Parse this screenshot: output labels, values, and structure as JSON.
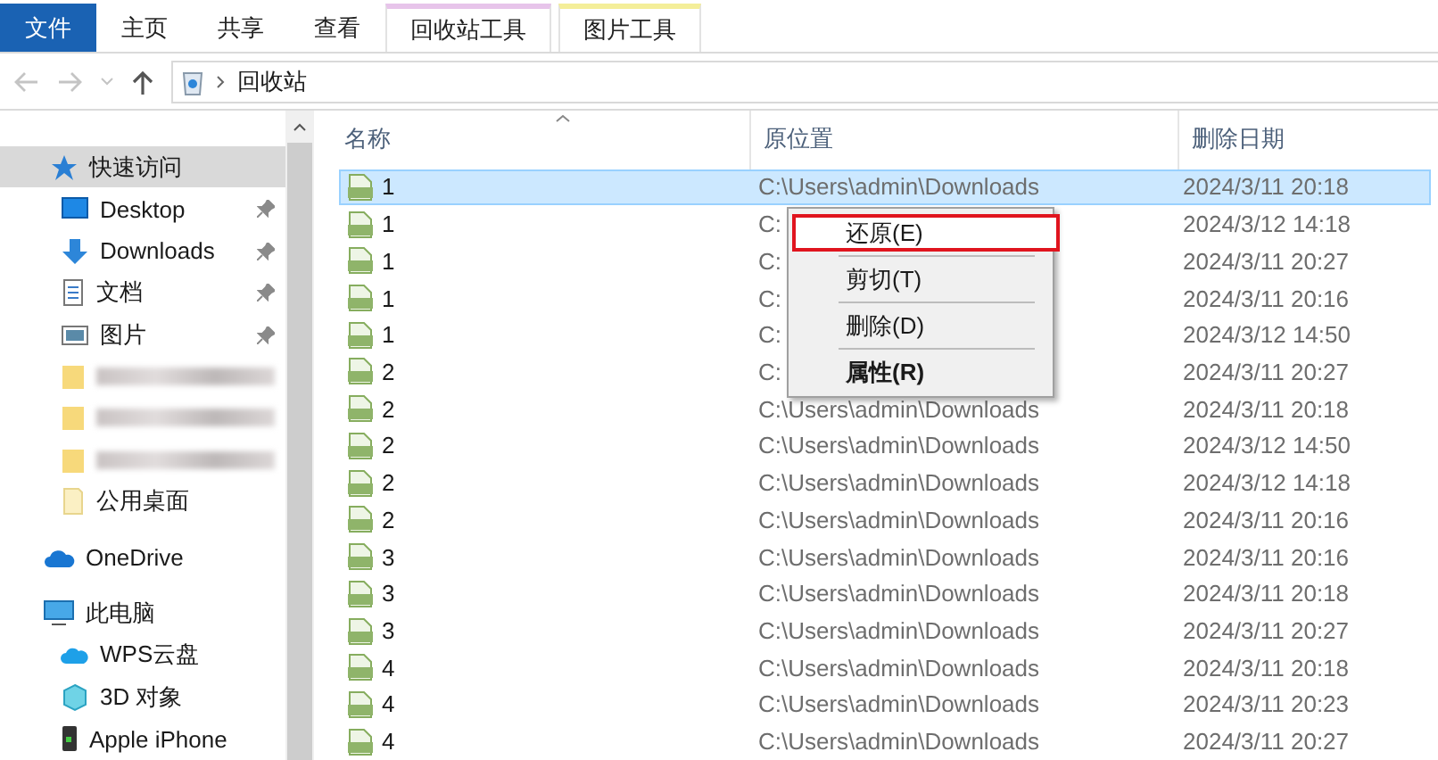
{
  "ribbon_tabs": [
    {
      "label": "文件",
      "kind": "file",
      "selected": false
    },
    {
      "label": "主页",
      "kind": "plain",
      "selected": false
    },
    {
      "label": "共享",
      "kind": "plain",
      "selected": false
    },
    {
      "label": "查看",
      "kind": "plain",
      "selected": false
    },
    {
      "label": "回收站工具",
      "kind": "context",
      "color": "#e7c4ea",
      "selected": false
    },
    {
      "label": "图片工具",
      "kind": "context",
      "color": "#f4ee99",
      "selected": false
    }
  ],
  "address_bar": {
    "path": "回收站"
  },
  "sidebar": {
    "items": [
      {
        "label": "快速访问",
        "selected": true,
        "children": [
          {
            "label": "Desktop",
            "pinned": true,
            "kind": "item"
          },
          {
            "label": "Downloads",
            "pinned": true,
            "kind": "item"
          },
          {
            "label": "文档",
            "pinned": true,
            "kind": "item"
          },
          {
            "label": "图片",
            "pinned": true,
            "kind": "item"
          },
          {
            "kind": "blurred",
            "pinned": false
          },
          {
            "kind": "blurred",
            "pinned": false
          },
          {
            "kind": "blurred",
            "pinned": false
          },
          {
            "label": "公用桌面",
            "pinned": false,
            "kind": "item"
          }
        ]
      },
      {
        "label": "OneDrive",
        "selected": false
      },
      {
        "label": "此电脑",
        "selected": false,
        "children": [
          {
            "label": "WPS云盘",
            "pinned": false,
            "kind": "item"
          },
          {
            "label": "3D 对象",
            "pinned": false,
            "kind": "item"
          },
          {
            "label": "Apple iPhone",
            "pinned": false,
            "kind": "item"
          }
        ]
      }
    ]
  },
  "table": {
    "columns": [
      "名称",
      "原位置",
      "删除日期"
    ],
    "rows": [
      {
        "name": "1",
        "location": "C:\\Users\\admin\\Downloads",
        "date": "2024/3/11 20:18",
        "selected": true
      },
      {
        "name": "1",
        "location": "C:",
        "date": "2024/3/12 14:18",
        "selected": false
      },
      {
        "name": "1",
        "location": "C:",
        "date": "2024/3/11 20:27",
        "selected": false
      },
      {
        "name": "1",
        "location": "C:",
        "date": "2024/3/11 20:16",
        "selected": false
      },
      {
        "name": "1",
        "location": "C:",
        "date": "2024/3/12 14:50",
        "selected": false
      },
      {
        "name": "2",
        "location": "C:",
        "date": "2024/3/11 20:27",
        "selected": false
      },
      {
        "name": "2",
        "location": "C:\\Users\\admin\\Downloads",
        "date": "2024/3/11 20:18",
        "selected": false
      },
      {
        "name": "2",
        "location": "C:\\Users\\admin\\Downloads",
        "date": "2024/3/12 14:50",
        "selected": false
      },
      {
        "name": "2",
        "location": "C:\\Users\\admin\\Downloads",
        "date": "2024/3/12 14:18",
        "selected": false
      },
      {
        "name": "2",
        "location": "C:\\Users\\admin\\Downloads",
        "date": "2024/3/11 20:16",
        "selected": false
      },
      {
        "name": "3",
        "location": "C:\\Users\\admin\\Downloads",
        "date": "2024/3/11 20:16",
        "selected": false
      },
      {
        "name": "3",
        "location": "C:\\Users\\admin\\Downloads",
        "date": "2024/3/11 20:18",
        "selected": false
      },
      {
        "name": "3",
        "location": "C:\\Users\\admin\\Downloads",
        "date": "2024/3/11 20:27",
        "selected": false
      },
      {
        "name": "4",
        "location": "C:\\Users\\admin\\Downloads",
        "date": "2024/3/11 20:18",
        "selected": false
      },
      {
        "name": "4",
        "location": "C:\\Users\\admin\\Downloads",
        "date": "2024/3/11 20:23",
        "selected": false
      },
      {
        "name": "4",
        "location": "C:\\Users\\admin\\Downloads",
        "date": "2024/3/11 20:27",
        "selected": false
      }
    ]
  },
  "context_menu": {
    "items": [
      {
        "kind": "item",
        "label": "还原(E)",
        "marked": true,
        "bold": false
      },
      {
        "kind": "separator"
      },
      {
        "kind": "item",
        "label": "剪切(T)",
        "marked": false,
        "bold": false
      },
      {
        "kind": "separator"
      },
      {
        "kind": "item",
        "label": "删除(D)",
        "marked": false,
        "bold": false
      },
      {
        "kind": "separator"
      },
      {
        "kind": "item",
        "label": "属性(R)",
        "marked": false,
        "bold": true
      }
    ]
  }
}
